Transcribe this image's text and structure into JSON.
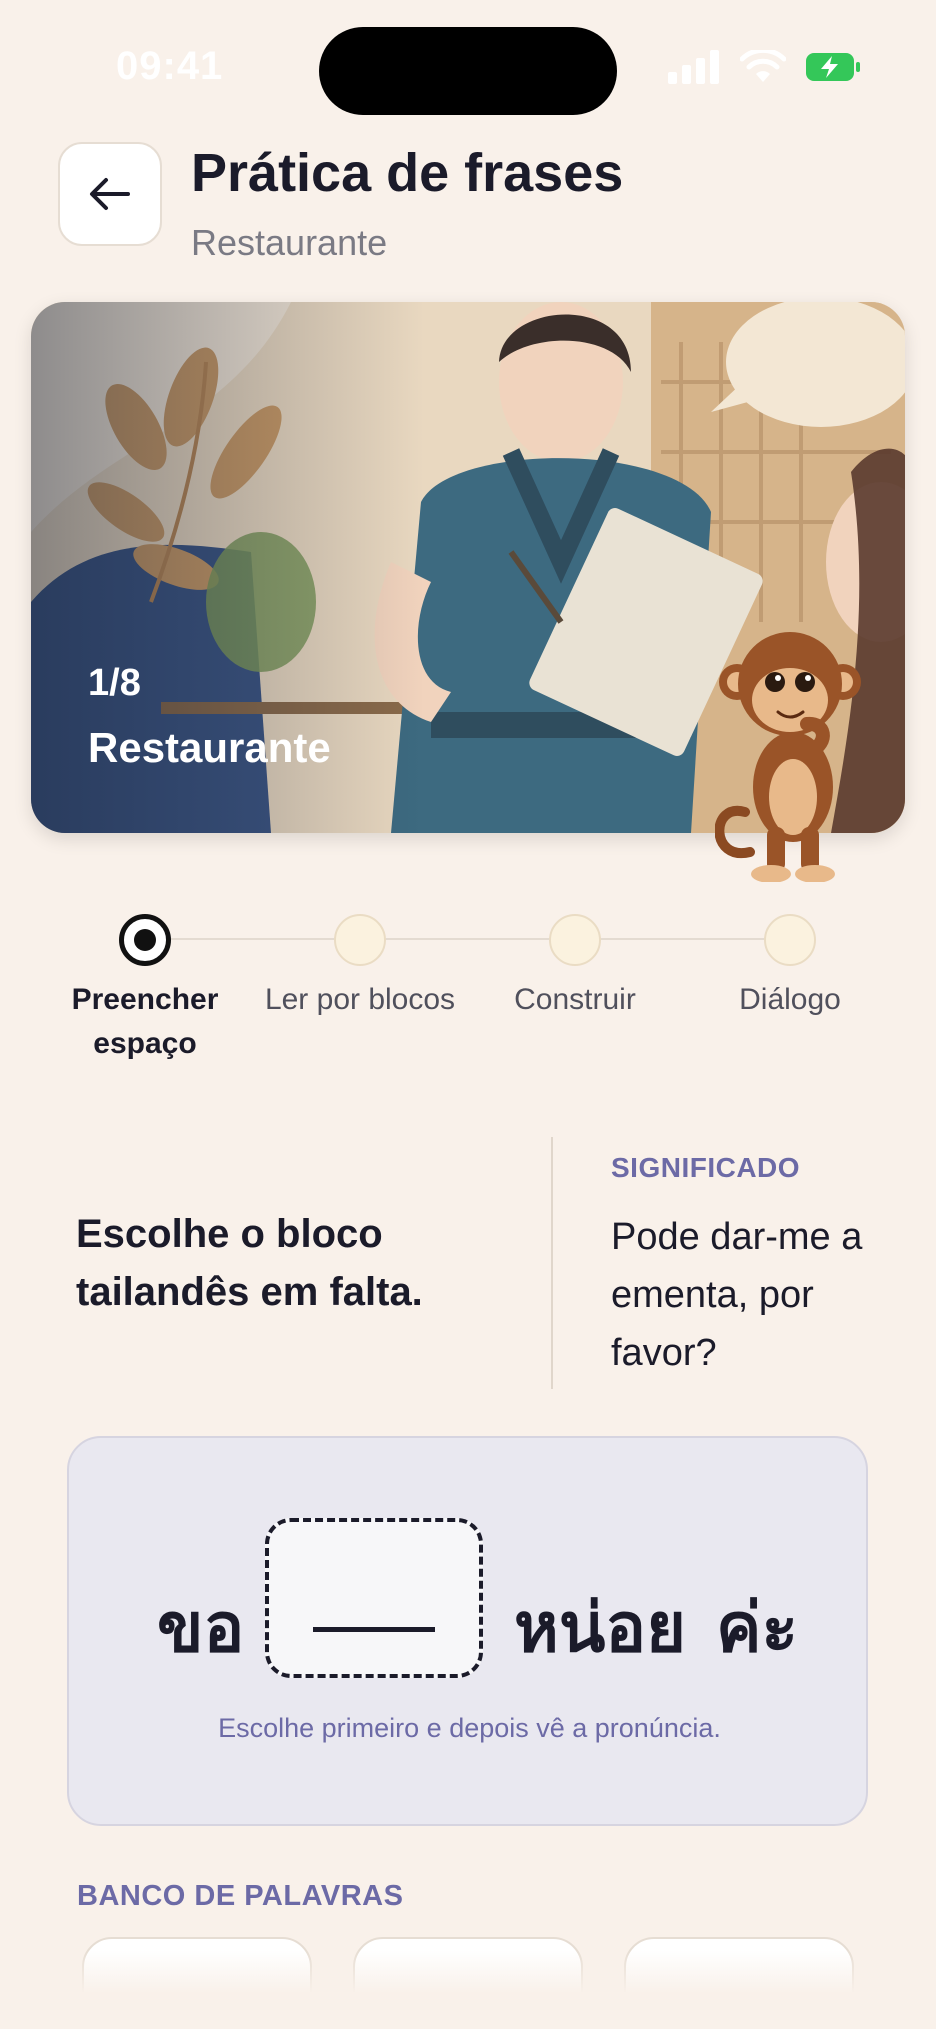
{
  "status_bar": {
    "time": "09:41"
  },
  "header": {
    "title": "Prática de frases",
    "subtitle": "Restaurante"
  },
  "hero": {
    "counter": "1/8",
    "label": "Restaurante"
  },
  "stepper": {
    "steps": [
      {
        "label": "Preencher espaço",
        "active": true
      },
      {
        "label": "Ler por blocos",
        "active": false
      },
      {
        "label": "Construir",
        "active": false
      },
      {
        "label": "Diálogo",
        "active": false
      }
    ]
  },
  "exercise": {
    "instruction": "Escolhe o bloco tailandês em falta.",
    "meaning_heading": "SIGNIFICADO",
    "meaning_text": "Pode dar-me a ementa, por favor?"
  },
  "sentence": {
    "word_before": "ขอ",
    "word_after_1": "หน่อย",
    "word_after_2": "ค่ะ",
    "hint": "Escolhe primeiro e depois vê a pronúncia."
  },
  "word_bank": {
    "heading": "BANCO DE PALAVRAS"
  },
  "colors": {
    "background": "#f9f1ea",
    "accent": "#6c6aa6",
    "battery": "#34c759"
  }
}
